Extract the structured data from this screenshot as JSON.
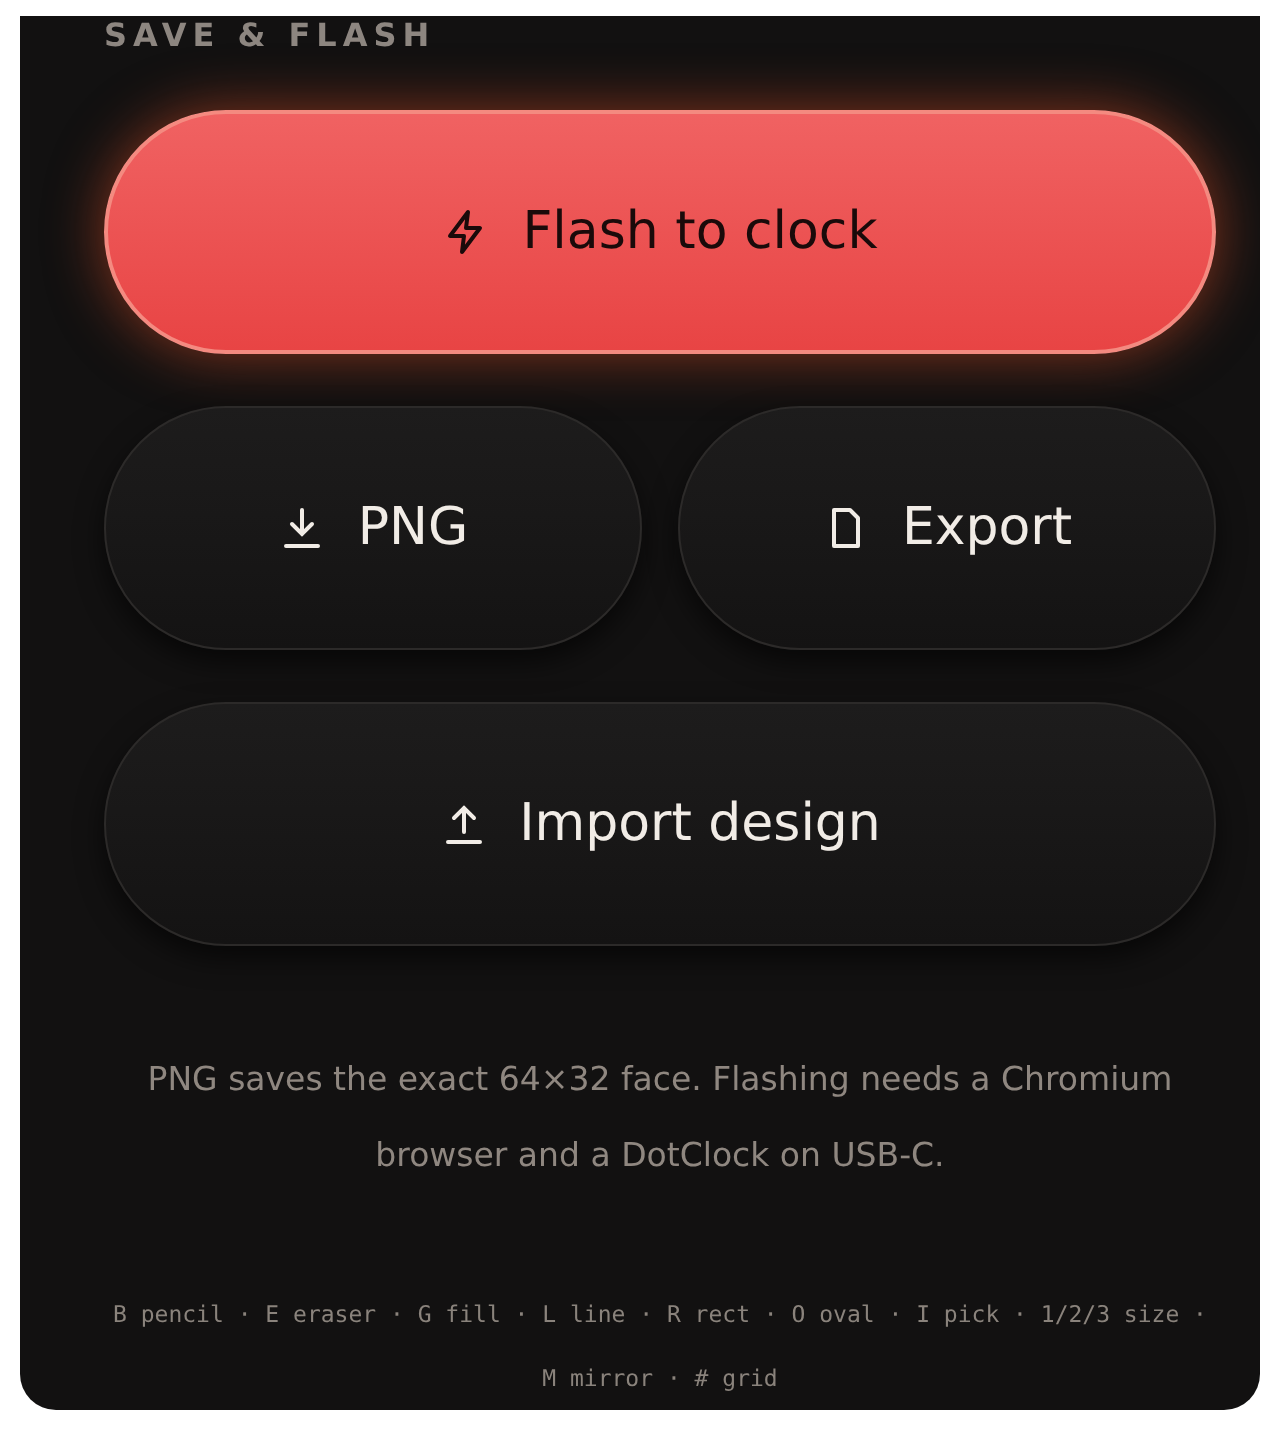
{
  "section": {
    "title": "SAVE & FLASH"
  },
  "buttons": [
    {
      "label": "Flash to clock",
      "kind": "flash"
    },
    {
      "label": "PNG",
      "kind": "download"
    },
    {
      "label": "Export",
      "kind": "export"
    },
    {
      "label": "Import design",
      "kind": "import"
    }
  ],
  "hint": "PNG saves the exact 64×32 face. Flashing needs a Chromium browser and a DotClock on USB-C.",
  "shortcuts": "B pencil · E eraser · G fill · L line · R rect · O oval · I pick · 1/2/3 size · M mirror · # grid"
}
